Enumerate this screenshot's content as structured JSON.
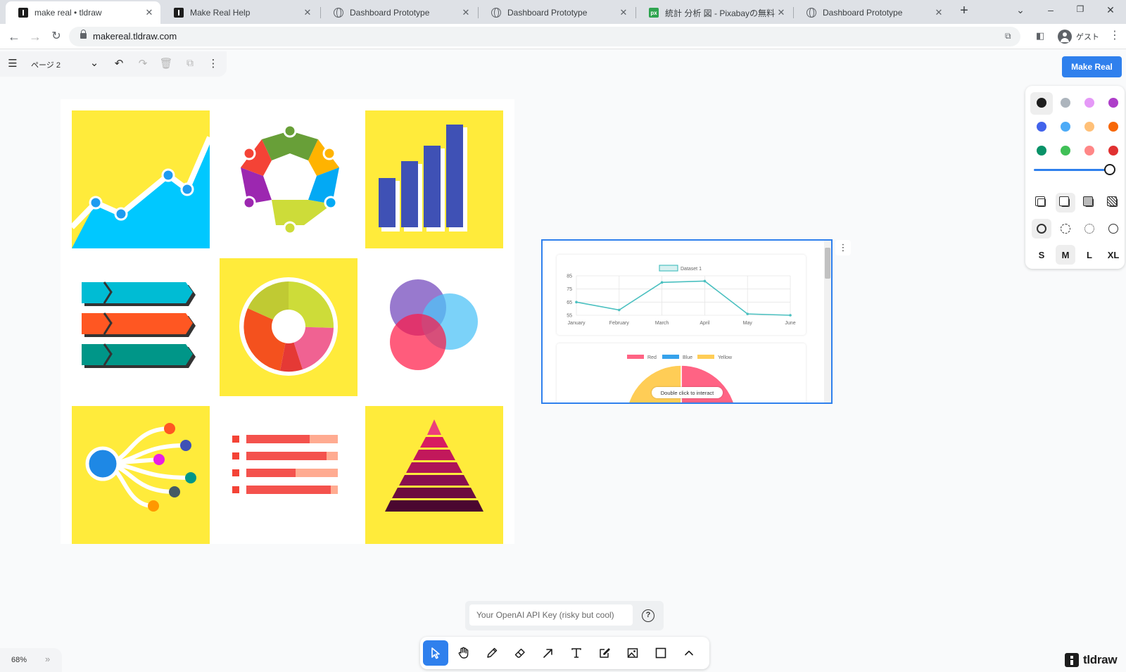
{
  "browser": {
    "tabs": [
      {
        "title": "make real • tldraw",
        "favicon": "tldraw-icon",
        "active": true
      },
      {
        "title": "Make Real Help",
        "favicon": "tldraw-icon",
        "active": false
      },
      {
        "title": "Dashboard Prototype",
        "favicon": "globe-icon",
        "active": false
      },
      {
        "title": "Dashboard Prototype",
        "favicon": "globe-icon",
        "active": false
      },
      {
        "title": "統計 分析 図 - Pixabayの無料ベクター",
        "favicon": "pixabay-icon",
        "active": false
      },
      {
        "title": "Dashboard Prototype",
        "favicon": "globe-icon",
        "active": false
      }
    ],
    "new_tab": "+",
    "url": "makereal.tldraw.com",
    "profile_label": "ゲスト"
  },
  "app": {
    "page_name": "ページ 2",
    "make_real_label": "Make Real",
    "zoom": "68%",
    "api_key": {
      "value": "",
      "placeholder": "Your OpenAI API Key (risky but cool)"
    },
    "help_glyph": "?",
    "logo_text": "tldraw",
    "style_panel": {
      "colors": [
        "#1d1d1d",
        "#adb5bd",
        "#e599f7",
        "#ae3ec9",
        "#4263eb",
        "#4dabf7",
        "#ffc078",
        "#f76707",
        "#099268",
        "#40c057",
        "#ff8787",
        "#e03131"
      ],
      "selected_color": "#1d1d1d",
      "opacity": 1.0,
      "sizes": [
        "S",
        "M",
        "L",
        "XL"
      ],
      "selected_size": "M"
    },
    "tools": [
      "select",
      "hand",
      "draw",
      "eraser",
      "arrow",
      "text",
      "note",
      "image",
      "rectangle",
      "more"
    ],
    "selected_tool": "select"
  },
  "preview": {
    "overlay_text": "Double click to interact",
    "line_chart": {
      "type": "line",
      "legend": [
        "Dataset 1"
      ],
      "categories": [
        "January",
        "February",
        "March",
        "April",
        "May",
        "June"
      ],
      "values": [
        65,
        59,
        80,
        81,
        56,
        55
      ],
      "yticks": [
        55,
        65,
        75,
        85
      ],
      "ylim": [
        55,
        85
      ],
      "color": "#4bc0c0"
    },
    "pie_chart": {
      "type": "pie",
      "legend": [
        {
          "name": "Red",
          "color": "#ff6384"
        },
        {
          "name": "Blue",
          "color": "#36a2eb"
        },
        {
          "name": "Yellow",
          "color": "#ffcd56"
        }
      ]
    }
  }
}
